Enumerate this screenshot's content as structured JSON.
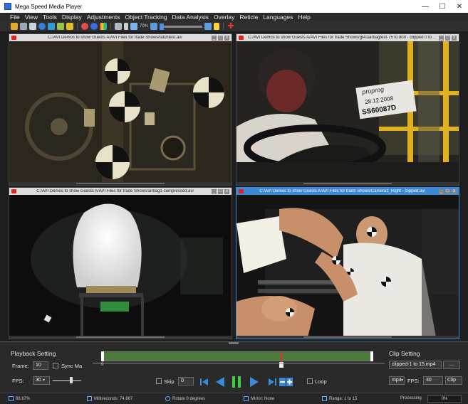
{
  "app": {
    "title": "Mega Speed Media Player"
  },
  "window_controls": {
    "minimize": "—",
    "maximize": "☐",
    "close": "✕"
  },
  "menu": [
    "File",
    "View",
    "Tools",
    "Display",
    "Adjustments",
    "Object Tracking",
    "Data Analysis",
    "Overlay",
    "Reticle",
    "Languages",
    "Help"
  ],
  "toolbar": {
    "zoom_label": "70%"
  },
  "panels": [
    {
      "title": "C:/AVI Demos to show Guests A/AVI Files for trade Shows/latchtest.avi",
      "active": false
    },
    {
      "title": "C:/AVI Demos to show Guests A/AVI Files for trade Shows/gr41airbagtest-75 to 800 - clipped 0 to ...",
      "active": false
    },
    {
      "title": "C:/AVI Demos to show Guests A/AVI Files for trade Shows/airbag1-compressed.avi",
      "active": false
    },
    {
      "title": "C:/AVI Demos to show Guests A/AVI Files for trade Shows/Camera1_Right - clipped.avi",
      "active": true
    }
  ],
  "panel_buttons": {
    "minimize": "_",
    "restore": "□",
    "close": "x"
  },
  "video_text": {
    "plate_top": "proprog",
    "plate_date": "28.12.2008",
    "plate_id": "SS60087D"
  },
  "playback": {
    "group_label": "Playback Setting",
    "frame_label": "Frame:",
    "frame_value": "10",
    "sync_label": "Sync Ma",
    "fps_label": "FPS:",
    "fps_value": "30"
  },
  "timeline": {
    "start_label": "0",
    "position": 0.66
  },
  "transport": {
    "skip_label": "Skip",
    "skip_value": "0",
    "loop_label": "Loop"
  },
  "clip": {
    "group_label": "Clip Setting",
    "filename": "clipped-1 to 15.mp4",
    "browse_label": "...",
    "format_value": "mp4",
    "fps_label": "FPS:",
    "fps_value": "30",
    "clip_button": "Clip"
  },
  "status": {
    "zoom": "66.67%",
    "milliseconds": "Milliseconds: 74.667",
    "rotate": "Rotate 0 degrees",
    "mirror": "Mirror: None",
    "range": "Range: 1 to 15",
    "processing_label": "Processing",
    "processing_value": "0%"
  },
  "colors": {
    "accent_blue": "#3a8ad8",
    "timeline_green": "#4b7a3a",
    "play_green": "#3ecf3e",
    "marker_red": "#e03030"
  }
}
